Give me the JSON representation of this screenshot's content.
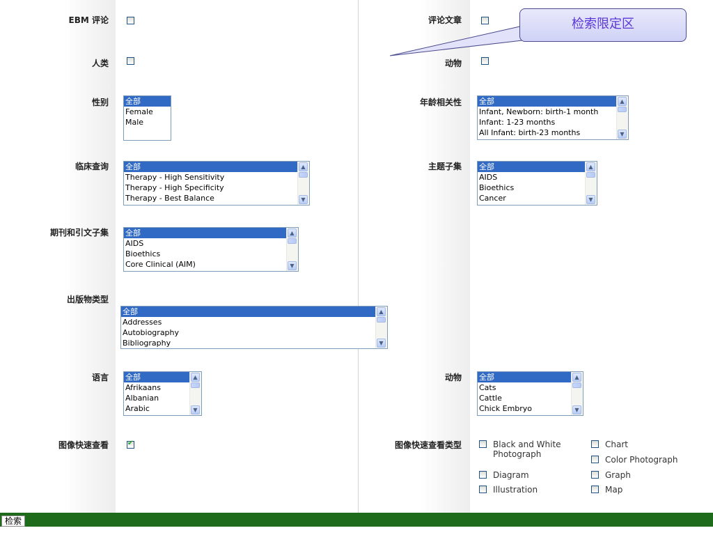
{
  "labels": {
    "ebm_review": "EBM 评论",
    "review_article": "评论文章",
    "humans": "人类",
    "animals": "动物",
    "gender": "性别",
    "age": "年龄相关性",
    "clinical_query": "临床查询",
    "subject_subset": "主题子集",
    "journal_subset": "期刊和引文子集",
    "publication_type": "出版物类型",
    "language": "语言",
    "animal_list": "动物",
    "image_quick_view": "图像快速查看",
    "image_quick_view_type": "图像快速查看类型"
  },
  "callout": {
    "text": "检索限定区"
  },
  "lists": {
    "gender": [
      "全部",
      "Female",
      "Male"
    ],
    "age": [
      "全部",
      "Infant, Newborn: birth-1 month",
      "Infant: 1-23 months",
      "All Infant: birth-23 months"
    ],
    "clinical": [
      "全部",
      "Therapy - High Sensitivity",
      "Therapy - High Specificity",
      "Therapy - Best Balance"
    ],
    "subject": [
      "全部",
      "AIDS",
      "Bioethics",
      "Cancer"
    ],
    "journal": [
      "全部",
      "AIDS",
      "Bioethics",
      "Core Clinical (AIM)"
    ],
    "pubtype": [
      "全部",
      "Addresses",
      "Autobiography",
      "Bibliography"
    ],
    "language": [
      "全部",
      "Afrikaans",
      "Albanian",
      "Arabic"
    ],
    "animal": [
      "全部",
      "Cats",
      "Cattle",
      "Chick Embryo"
    ]
  },
  "image_types": {
    "bw_photo_line1": "Black and White",
    "bw_photo_line2": "Photograph",
    "chart": "Chart",
    "color_photo": "Color Photograph",
    "diagram": "Diagram",
    "graph": "Graph",
    "illustration": "Illustration",
    "map": "Map"
  },
  "checkbox_states": {
    "ebm_review": false,
    "review_article": false,
    "humans": false,
    "animals": false,
    "image_quick_view": true
  },
  "search_button": "检索",
  "colors": {
    "bottom_bar": "#1e6b1c",
    "selected_option": "#316ac5",
    "callout_text": "#5a36d6"
  }
}
